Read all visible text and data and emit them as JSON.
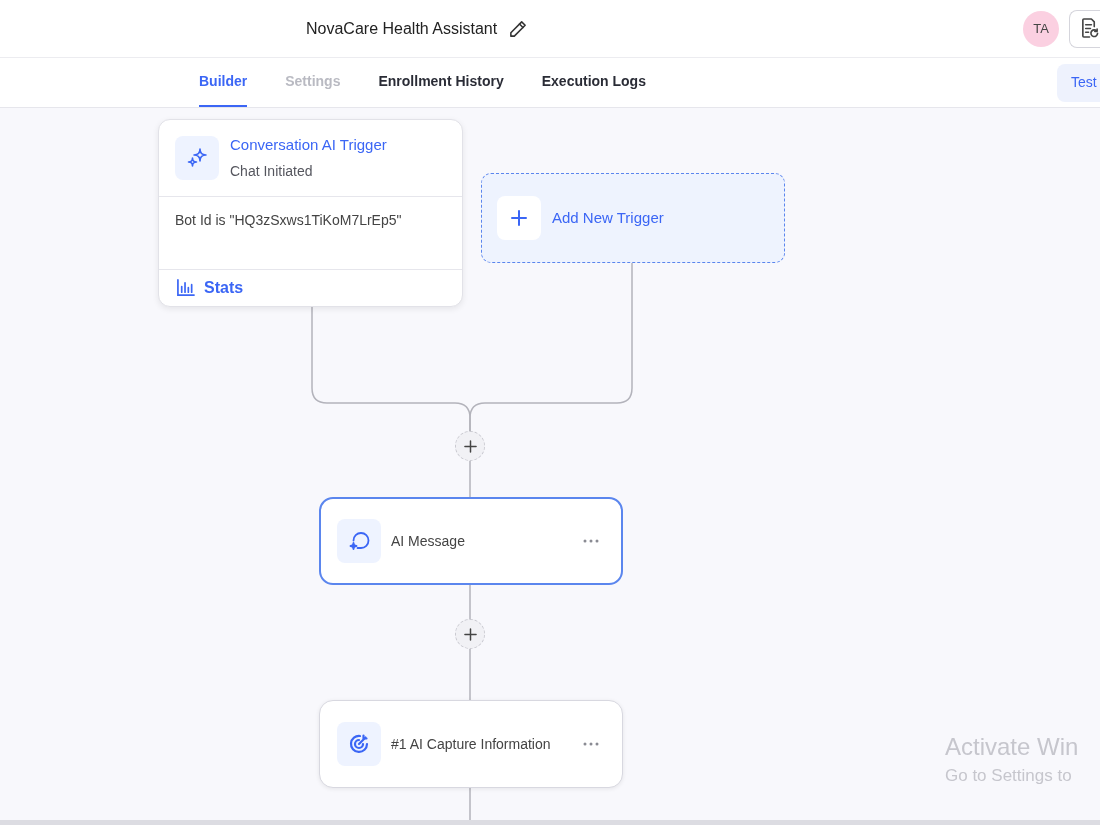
{
  "header": {
    "title": "NovaCare Health Assistant",
    "avatar_initials": "TA"
  },
  "tabs": [
    {
      "label": "Builder",
      "selected": true,
      "disabled": false
    },
    {
      "label": "Settings",
      "selected": false,
      "disabled": true
    },
    {
      "label": "Enrollment History",
      "selected": false,
      "disabled": false
    },
    {
      "label": "Execution Logs",
      "selected": false,
      "disabled": false
    }
  ],
  "test_button": "Test",
  "canvas": {
    "triggers": [
      {
        "kind": "trigger",
        "title": "Conversation AI Trigger",
        "subtitle": "Chat Initiated",
        "condition": "Bot Id is \"HQ3zSxws1TiKoM7LrEp5\"",
        "stats_label": "Stats"
      },
      {
        "kind": "add",
        "label": "Add New Trigger"
      }
    ],
    "steps": [
      {
        "kind": "message",
        "label": "AI Message",
        "selected": true
      },
      {
        "kind": "capture",
        "label": "#1 AI Capture Information",
        "selected": false
      }
    ]
  },
  "system_notice": {
    "title": "Activate Win",
    "subtitle": "Go to Settings to"
  }
}
